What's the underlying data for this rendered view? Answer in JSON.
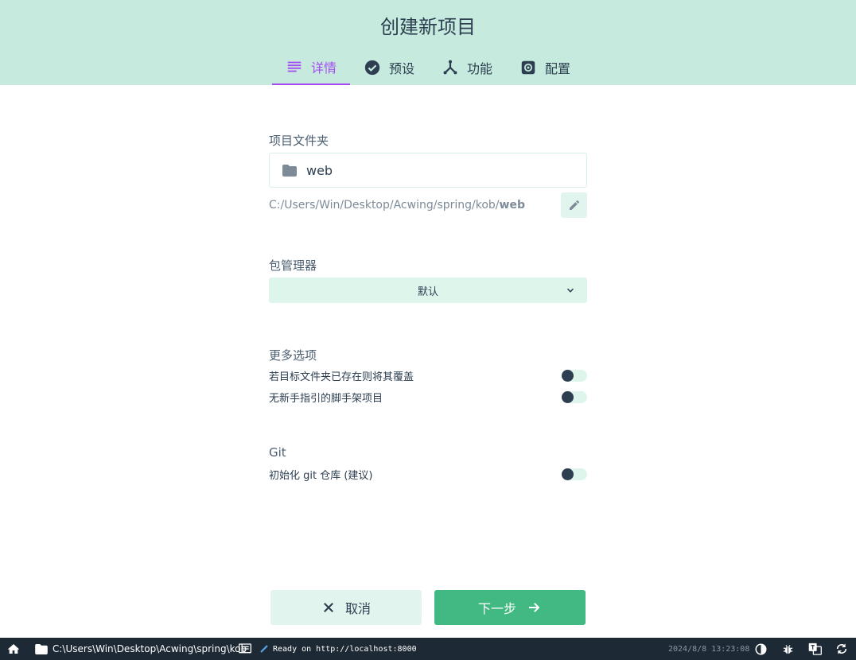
{
  "header": {
    "title": "创建新项目",
    "tabs": [
      {
        "label": "详情",
        "icon": "list-icon",
        "active": true
      },
      {
        "label": "预设",
        "icon": "check-circle-icon",
        "active": false
      },
      {
        "label": "功能",
        "icon": "fork-icon",
        "active": false
      },
      {
        "label": "配置",
        "icon": "gear-icon",
        "active": false
      }
    ]
  },
  "folder": {
    "label": "项目文件夹",
    "value": "web",
    "path_prefix": "C:/Users/Win/Desktop/Acwing/spring/kob/",
    "path_last": "web"
  },
  "package_manager": {
    "label": "包管理器",
    "selected": "默认"
  },
  "more_options": {
    "label": "更多选项",
    "items": [
      {
        "label": "若目标文件夹已存在则将其覆盖",
        "enabled": false
      },
      {
        "label": "无新手指引的脚手架项目",
        "enabled": false
      }
    ]
  },
  "git": {
    "label": "Git",
    "items": [
      {
        "label": "初始化 git 仓库 (建议)",
        "enabled": false
      }
    ]
  },
  "actions": {
    "cancel_label": "取消",
    "next_label": "下一步"
  },
  "statusbar": {
    "path": "C:\\Users\\Win\\Desktop\\Acwing\\spring\\kob",
    "status": "Ready on http://localhost:8000",
    "datetime": "2024/8/8 13:23:08"
  },
  "colors": {
    "header_bg": "#c6eade",
    "accent": "#a44cf1",
    "primary": "#42b983",
    "statusbar_bg": "#1d2935"
  }
}
